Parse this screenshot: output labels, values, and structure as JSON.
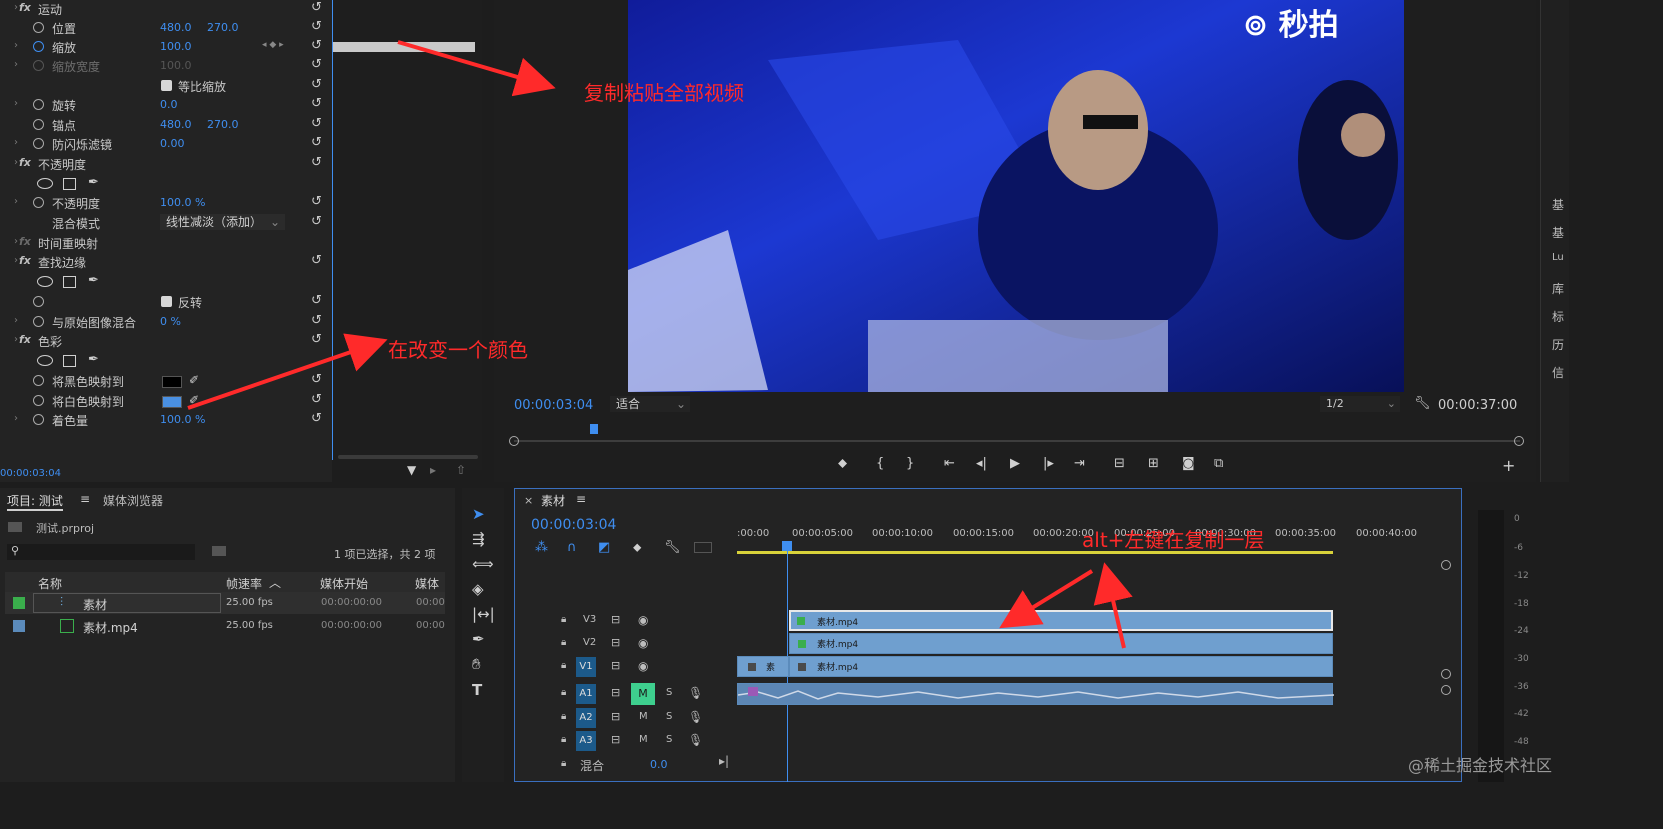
{
  "effects": {
    "rows": [
      {
        "label": "运动",
        "value1": "",
        "value2": ""
      },
      {
        "label": "位置",
        "value1": "480.0",
        "value2": "270.0"
      },
      {
        "label": "缩放",
        "value1": "100.0",
        "value2": ""
      },
      {
        "label": "缩放宽度",
        "value1": "100.0",
        "value2": ""
      },
      {
        "label": "等比缩放",
        "value1": "",
        "value2": ""
      },
      {
        "label": "旋转",
        "value1": "0.0",
        "value2": ""
      },
      {
        "label": "锚点",
        "value1": "480.0",
        "value2": "270.0"
      },
      {
        "label": "防闪烁滤镜",
        "value1": "0.00",
        "value2": ""
      },
      {
        "label": "不透明度",
        "value1": "",
        "value2": ""
      },
      {
        "label": "不透明度",
        "value1": "100.0 %",
        "value2": ""
      },
      {
        "label": "混合模式",
        "value1": "线性减淡（添加）",
        "value2": ""
      },
      {
        "label": "时间重映射",
        "value1": "",
        "value2": ""
      },
      {
        "label": "查找边缘",
        "value1": "",
        "value2": ""
      },
      {
        "label": "反转",
        "value1": "",
        "value2": ""
      },
      {
        "label": "与原始图像混合",
        "value1": "0 %",
        "value2": ""
      },
      {
        "label": "色彩",
        "value1": "",
        "value2": ""
      },
      {
        "label": "将黑色映射到",
        "value1": "",
        "value2": ""
      },
      {
        "label": "将白色映射到",
        "value1": "",
        "value2": ""
      },
      {
        "label": "着色量",
        "value1": "100.0 %",
        "value2": ""
      }
    ],
    "timecode": "00:00:03:04",
    "black_color": "#000000",
    "white_map_color": "#4a90e2"
  },
  "program": {
    "watermark": "秒拍",
    "timecode": "00:00:03:04",
    "fit": "适合",
    "resolution": "1/2",
    "duration": "00:00:37:00",
    "playhead_fraction": 0.08
  },
  "right_tabs": [
    "基",
    "基",
    "Lu",
    "库",
    "标",
    "历",
    "信"
  ],
  "project": {
    "tab_project": "项目: 测试",
    "tab_media": "媒体浏览器",
    "file": "测试.prproj",
    "selection": "1 项已选择，共 2 项",
    "headers": [
      "名称",
      "帧速率",
      "媒体开始",
      "媒体"
    ],
    "items": [
      {
        "name": "素材",
        "fps": "25.00 fps",
        "start": "00:00:00:00",
        "end": "00:00",
        "color": "#3aae4c"
      },
      {
        "name": "素材.mp4",
        "fps": "25.00 fps",
        "start": "00:00:00:00",
        "end": "00:00",
        "color": "#5b8bbb"
      }
    ]
  },
  "timeline": {
    "tab": "素材",
    "timecode": "00:00:03:04",
    "ruler": [
      ":00:00",
      "00:00:05:00",
      "00:00:10:00",
      "00:00:15:00",
      "00:00:20:00",
      "00:00:25:00",
      "00:00:30:00",
      "00:00:35:00",
      "00:00:40:00"
    ],
    "tracks": [
      {
        "name": "V3",
        "clip": "素材.mp4"
      },
      {
        "name": "V2",
        "clip": "素材.mp4"
      },
      {
        "name": "V1",
        "clip": "素材.mp4",
        "extra": "素"
      },
      {
        "name": "A1"
      },
      {
        "name": "A2"
      },
      {
        "name": "A3"
      }
    ],
    "mix_label": "混合",
    "mix_value": "0.0",
    "m_label": "M",
    "s_label": "S"
  },
  "meter_ticks": [
    "0",
    "-6",
    "-12",
    "-18",
    "-24",
    "-30",
    "-36",
    "-42",
    "-48"
  ],
  "annotations": {
    "copy_paste": "复制粘贴全部视频",
    "change_color": "在改变一个颜色",
    "alt_copy": "alt+左键在复制一层"
  },
  "watermark_site": "@稀土掘金技术社区"
}
